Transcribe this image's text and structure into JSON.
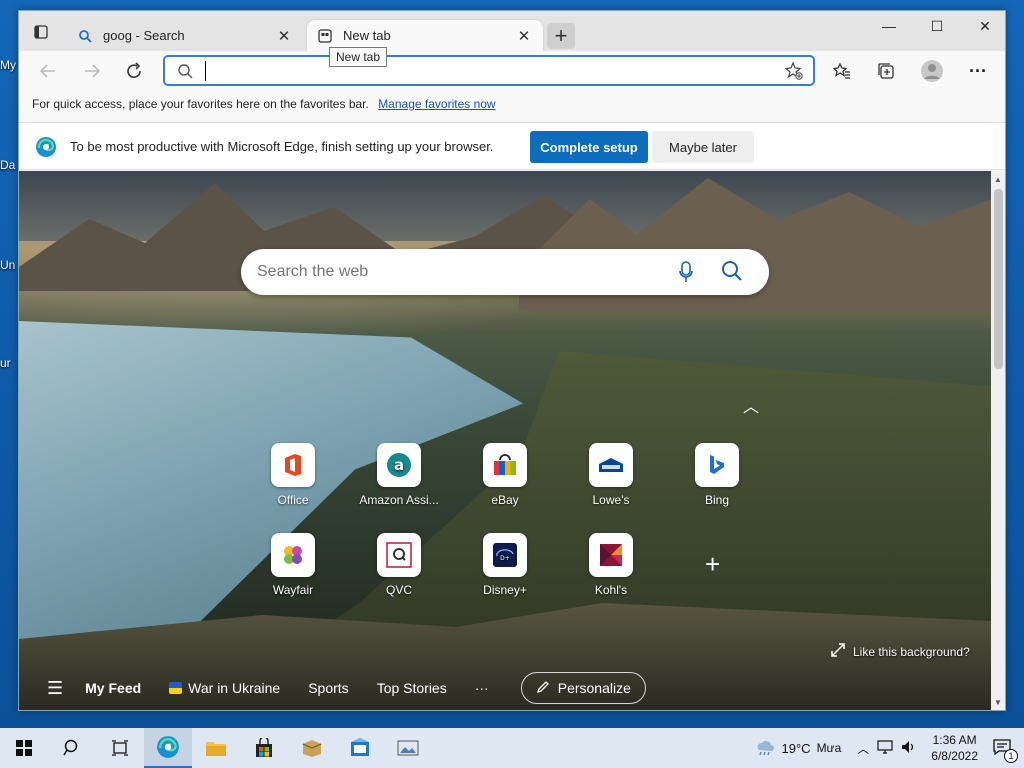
{
  "desktop": {
    "labels": [
      "My",
      "Da",
      "Un",
      "ur"
    ]
  },
  "browser": {
    "tabs": [
      {
        "title": "goog - Search",
        "active": false,
        "icon": "search-icon"
      },
      {
        "title": "New tab",
        "active": true,
        "icon": "newtab-page-icon"
      }
    ],
    "tooltip": "New tab",
    "address": {
      "value": "",
      "placeholder": ""
    },
    "favbar": {
      "text": "For quick access, place your favorites here on the favorites bar.",
      "link": "Manage favorites now"
    },
    "infobar": {
      "text": "To be most productive with Microsoft Edge, finish setting up your browser.",
      "primary": "Complete setup",
      "secondary": "Maybe later"
    }
  },
  "newtab": {
    "search_placeholder": "Search the web",
    "tiles_row1": [
      {
        "label": "Office",
        "icon": "office-icon"
      },
      {
        "label": "Amazon Assi...",
        "icon": "amazon-assistant-icon"
      },
      {
        "label": "eBay",
        "icon": "ebay-icon"
      },
      {
        "label": "Lowe's",
        "icon": "lowes-icon"
      },
      {
        "label": "Bing",
        "icon": "bing-icon"
      }
    ],
    "tiles_row2": [
      {
        "label": "Wayfair",
        "icon": "wayfair-icon"
      },
      {
        "label": "QVC",
        "icon": "qvc-icon"
      },
      {
        "label": "Disney+",
        "icon": "disney-plus-icon"
      },
      {
        "label": "Kohl's",
        "icon": "kohls-icon"
      }
    ],
    "like_background": "Like this background?",
    "feed": {
      "my_feed": "My Feed",
      "war": "War in Ukraine",
      "sports": "Sports",
      "top_stories": "Top Stories",
      "more": "···",
      "personalize": "Personalize"
    }
  },
  "taskbar": {
    "weather": "19°C",
    "weather_desc": "Mưa",
    "time": "1:36 AM",
    "date": "6/8/2022",
    "notif_count": "1"
  }
}
